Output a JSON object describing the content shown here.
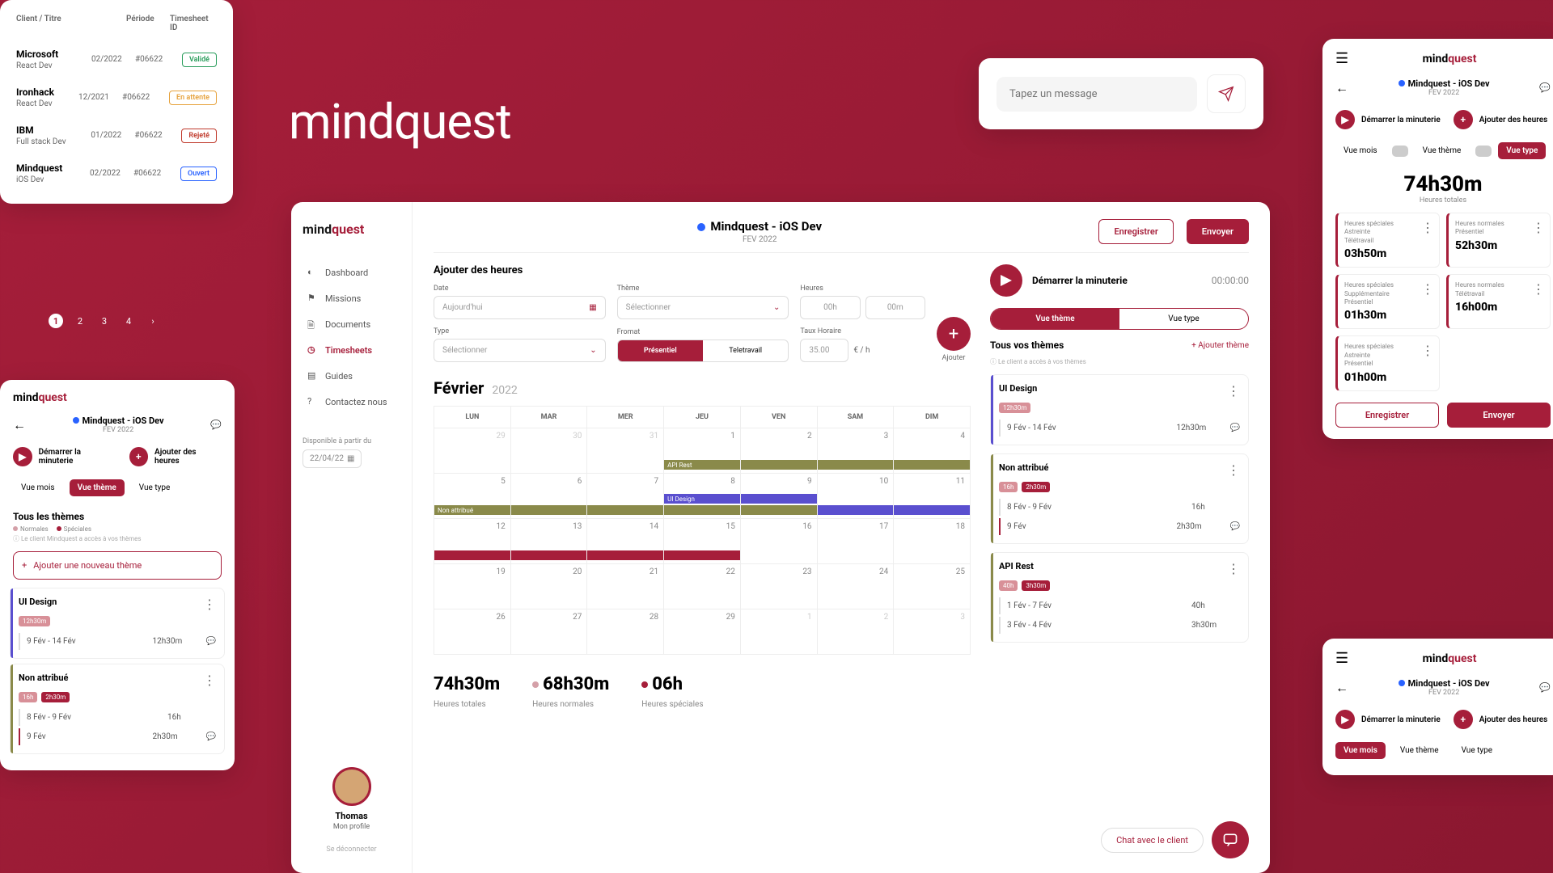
{
  "brand": "mindquest",
  "list": {
    "h1": "Client / Titre",
    "h2": "Période",
    "h3": "Timesheet ID",
    "rows": [
      {
        "c": "Microsoft",
        "r": "React Dev",
        "p": "02/2022",
        "id": "#06622",
        "s": "Validé",
        "cls": "g"
      },
      {
        "c": "Ironhack",
        "r": "React Dev",
        "p": "12/2021",
        "id": "#06622",
        "s": "En attente",
        "cls": "o"
      },
      {
        "c": "IBM",
        "r": "Full stack Dev",
        "p": "01/2022",
        "id": "#06622",
        "s": "Rejeté",
        "cls": "r"
      },
      {
        "c": "Mindquest",
        "r": "iOS Dev",
        "p": "02/2022",
        "id": "#06622",
        "s": "Ouvert",
        "cls": "b"
      }
    ],
    "pages": [
      "1",
      "2",
      "3",
      "4"
    ]
  },
  "chat": {
    "ph": "Tapez un message"
  },
  "app": {
    "title": "Mindquest - iOS Dev",
    "sub": "FEV 2022",
    "save": "Enregistrer",
    "send": "Envoyer",
    "nav": {
      "dash": "Dashboard",
      "miss": "Missions",
      "docs": "Documents",
      "ts": "Timesheets",
      "guides": "Guides",
      "contact": "Contactez nous"
    },
    "avail_l": "Disponible à partir du",
    "avail_v": "22/04/22",
    "profile": {
      "name": "Thomas",
      "sub": "Mon profile",
      "logout": "Se déconnecter"
    },
    "form": {
      "title": "Ajouter des heures",
      "date_l": "Date",
      "date_v": "Aujourd'hui",
      "theme_l": "Thème",
      "theme_v": "Sélectionner",
      "hours_l": "Heures",
      "h1": "00h",
      "h2": "00m",
      "type_l": "Type",
      "type_v": "Sélectionner",
      "format_l": "Fromat",
      "f1": "Présentiel",
      "f2": "Teletravail",
      "rate_l": "Taux Horaire",
      "rate_v": "35.00",
      "rate_u": "€ / h",
      "add": "Ajouter"
    },
    "month": "Février",
    "year": "2022",
    "wd": [
      "LUN",
      "MAR",
      "MER",
      "JEU",
      "VEN",
      "SAM",
      "DIM"
    ],
    "bars": {
      "api": "API Rest",
      "na": "Non attribué",
      "ui": "UI Design"
    },
    "totals": {
      "t1": "74h30m",
      "t1l": "Heures totales",
      "t2": "68h30m",
      "t2l": "Heures normales",
      "t3": "06h",
      "t3l": "Heures spéciales"
    },
    "timer": {
      "l": "Démarrer la minuterie",
      "v": "00:00:00"
    },
    "tabs": {
      "a": "Vue thème",
      "b": "Vue type"
    },
    "themes": {
      "title": "Tous vos thèmes",
      "add": "+ Ajouter thème",
      "hint": "ⓘ Le client a accès à vos thèmes"
    },
    "tcards": [
      {
        "name": "UI Design",
        "stripe": "#5a4fcf",
        "chips": [
          {
            "t": "12h30m",
            "c": "pink"
          }
        ],
        "rows": [
          {
            "d": "9 Fév - 14 Fév",
            "h": "12h30m",
            "chat": true
          }
        ]
      },
      {
        "name": "Non attribué",
        "stripe": "#8a8a4a",
        "chips": [
          {
            "t": "16h",
            "c": "pink"
          },
          {
            "t": "2h30m",
            "c": "dred"
          }
        ],
        "rows": [
          {
            "d": "8 Fév - 9 Fév",
            "h": "16h"
          },
          {
            "d": "9 Fév",
            "h": "2h30m",
            "chat": true,
            "red": true
          }
        ]
      },
      {
        "name": "API Rest",
        "stripe": "#8a8a4a",
        "chips": [
          {
            "t": "40h",
            "c": "pink"
          },
          {
            "t": "3h30m",
            "c": "dred"
          }
        ],
        "rows": [
          {
            "d": "1 Fév - 7 Fév",
            "h": "40h"
          },
          {
            "d": "3 Fév - 4 Fév",
            "h": "3h30m"
          }
        ]
      }
    ],
    "chat": "Chat avec le client"
  },
  "mob": {
    "title": "Mindquest - iOS Dev",
    "sub": "FEV 2022",
    "start": "Démarrer la minuterie",
    "add": "Ajouter des heures",
    "vmois": "Vue mois",
    "vtheme": "Vue thème",
    "vtype": "Vue type",
    "big": "74h30m",
    "big_l": "Heures totales",
    "cards": [
      {
        "t1": "Heures spéciales",
        "t2": "Astreinte",
        "t3": "Télétravail",
        "v": "03h50m"
      },
      {
        "t1": "Heures normales",
        "t2": "Présentiel",
        "t3": "",
        "v": "52h30m"
      },
      {
        "t1": "Heures spéciales",
        "t2": "Supplémentaire",
        "t3": "Présentiel",
        "v": "01h30m"
      },
      {
        "t1": "Heures normales",
        "t2": "Télétravail",
        "t3": "",
        "v": "16h00m"
      },
      {
        "t1": "Heures spéciales",
        "t2": "Astreinte",
        "t3": "Présentiel",
        "v": "01h00m"
      }
    ],
    "allth": "Tous les thèmes",
    "leg_n": "Normales",
    "leg_s": "Spéciales",
    "access": "ⓘ Le client Mindquest a accès à vos thèmes",
    "addth": "Ajouter une nouveau thème"
  }
}
